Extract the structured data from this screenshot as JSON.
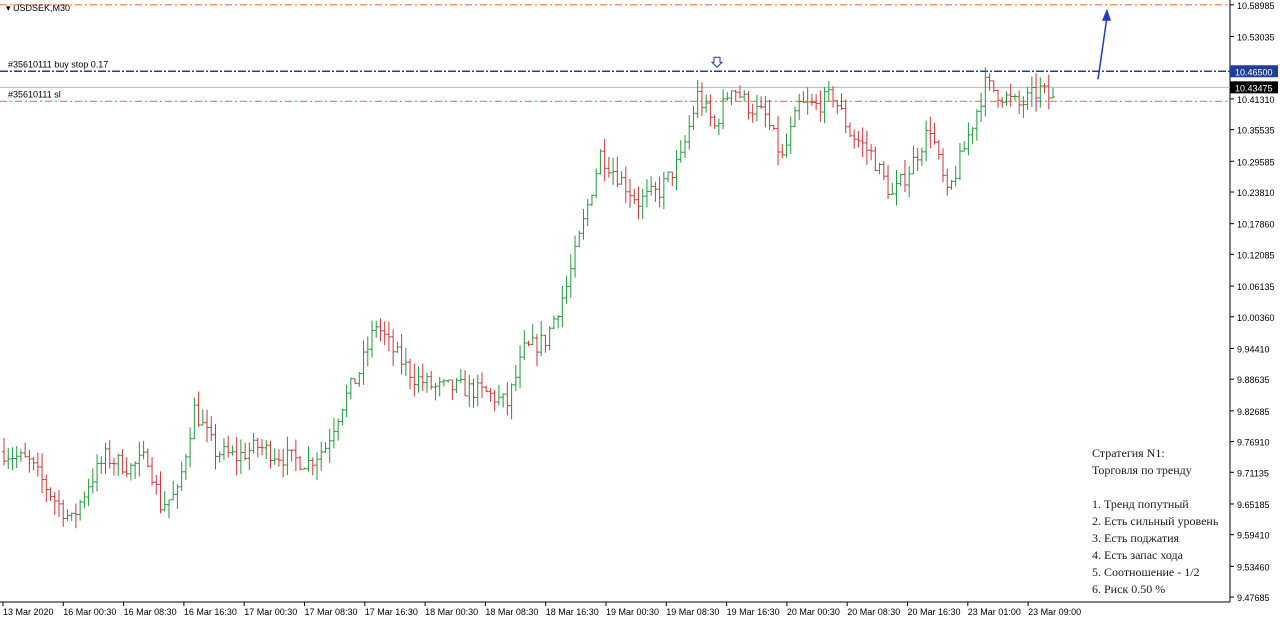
{
  "header": {
    "symbol": "USDSEK,M30"
  },
  "colors": {
    "up": "#1f9a3a",
    "down": "#d3343a",
    "order_line": "#1f3d99",
    "sl_line": "#f07a3a",
    "arrow": "#1f3dc8",
    "price_box": "#000000"
  },
  "labels": {
    "buy_stop": "#35610111 buy stop 0.17",
    "sl": "#35610111 sl"
  },
  "price_boxes": {
    "order": "10.46500",
    "current": "10.43475"
  },
  "note": {
    "title1": "Стратегия N1:",
    "title2": "Торговля по тренду",
    "items": [
      "1. Тренд попутный",
      "2. Есть сильный уровень",
      "3. Есть поджатия",
      "4. Есть запас хода",
      "5. Соотношение - 1/2",
      "6. Риск 0.50 %"
    ]
  },
  "chart_data": {
    "type": "candlestick",
    "title": "USDSEK,M30",
    "ylim": [
      9.4676,
      10.5989
    ],
    "y_ticks": [
      "10.58985",
      "10.53035",
      "10.46500",
      "10.43475",
      "10.41310",
      "10.35535",
      "10.29585",
      "10.23810",
      "10.17860",
      "10.12085",
      "10.06135",
      "10.00360",
      "9.94410",
      "9.88635",
      "9.82685",
      "9.76910",
      "9.71135",
      "9.65185",
      "9.59410",
      "9.53460",
      "9.47685"
    ],
    "x_ticks": [
      "13 Mar 2020",
      "16 Mar 00:30",
      "16 Mar 08:30",
      "16 Mar 16:30",
      "17 Mar 00:30",
      "17 Mar 08:30",
      "17 Mar 16:30",
      "18 Mar 00:30",
      "18 Mar 08:30",
      "18 Mar 16:30",
      "19 Mar 00:30",
      "19 Mar 08:30",
      "19 Mar 16:30",
      "20 Mar 00:30",
      "20 Mar 08:30",
      "20 Mar 16:30",
      "23 Mar 01:00",
      "23 Mar 09:00"
    ],
    "levels": {
      "buy_stop": 10.465,
      "stop_loss": 10.4085,
      "target": 10.5899,
      "current": 10.43475
    },
    "close_path": [
      [
        0,
        9.75
      ],
      [
        6,
        9.73
      ],
      [
        12,
        9.66
      ],
      [
        16,
        9.62
      ],
      [
        20,
        9.69
      ],
      [
        24,
        9.74
      ],
      [
        30,
        9.72
      ],
      [
        34,
        9.74
      ],
      [
        37,
        9.65
      ],
      [
        41,
        9.67
      ],
      [
        45,
        9.83
      ],
      [
        50,
        9.75
      ],
      [
        55,
        9.74
      ],
      [
        60,
        9.76
      ],
      [
        66,
        9.74
      ],
      [
        72,
        9.73
      ],
      [
        76,
        9.76
      ],
      [
        80,
        9.84
      ],
      [
        84,
        9.9
      ],
      [
        88,
        9.99
      ],
      [
        92,
        9.94
      ],
      [
        97,
        9.89
      ],
      [
        102,
        9.87
      ],
      [
        108,
        9.87
      ],
      [
        114,
        9.86
      ],
      [
        119,
        9.84
      ],
      [
        123,
        9.94
      ],
      [
        128,
        9.96
      ],
      [
        133,
        10.06
      ],
      [
        137,
        10.18
      ],
      [
        141,
        10.31
      ],
      [
        145,
        10.27
      ],
      [
        150,
        10.22
      ],
      [
        155,
        10.24
      ],
      [
        160,
        10.3
      ],
      [
        164,
        10.42
      ],
      [
        168,
        10.36
      ],
      [
        172,
        10.44
      ],
      [
        176,
        10.4
      ],
      [
        180,
        10.38
      ],
      [
        184,
        10.3
      ],
      [
        188,
        10.4
      ],
      [
        192,
        10.4
      ],
      [
        196,
        10.42
      ],
      [
        200,
        10.35
      ],
      [
        205,
        10.31
      ],
      [
        210,
        10.23
      ],
      [
        214,
        10.28
      ],
      [
        219,
        10.36
      ],
      [
        223,
        10.23
      ],
      [
        227,
        10.32
      ],
      [
        232,
        10.44
      ],
      [
        236,
        10.42
      ],
      [
        240,
        10.4
      ],
      [
        245,
        10.43
      ],
      [
        248,
        10.41
      ]
    ]
  }
}
